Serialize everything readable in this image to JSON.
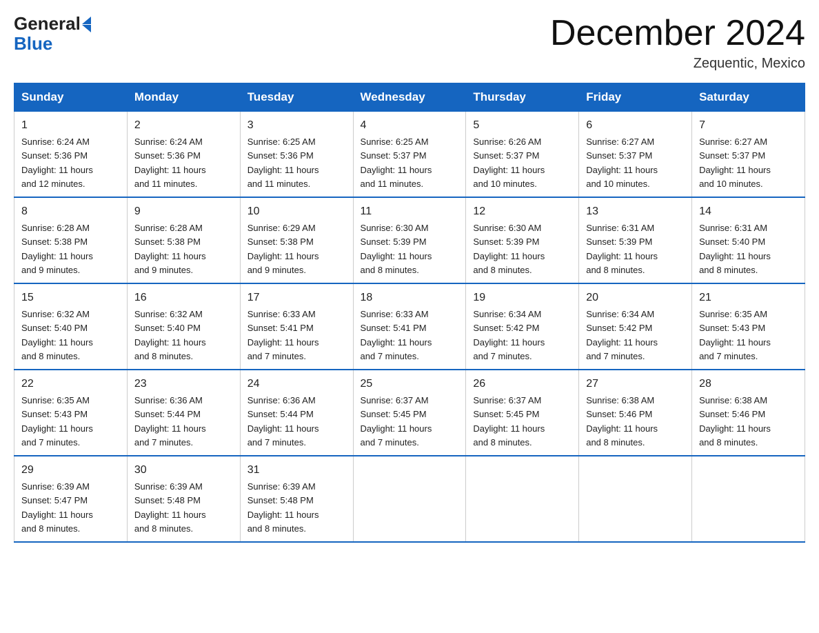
{
  "logo": {
    "general": "General",
    "blue": "Blue"
  },
  "title": "December 2024",
  "location": "Zequentic, Mexico",
  "days_of_week": [
    "Sunday",
    "Monday",
    "Tuesday",
    "Wednesday",
    "Thursday",
    "Friday",
    "Saturday"
  ],
  "weeks": [
    [
      {
        "day": "1",
        "sunrise": "6:24 AM",
        "sunset": "5:36 PM",
        "daylight": "11 hours and 12 minutes."
      },
      {
        "day": "2",
        "sunrise": "6:24 AM",
        "sunset": "5:36 PM",
        "daylight": "11 hours and 11 minutes."
      },
      {
        "day": "3",
        "sunrise": "6:25 AM",
        "sunset": "5:36 PM",
        "daylight": "11 hours and 11 minutes."
      },
      {
        "day": "4",
        "sunrise": "6:25 AM",
        "sunset": "5:37 PM",
        "daylight": "11 hours and 11 minutes."
      },
      {
        "day": "5",
        "sunrise": "6:26 AM",
        "sunset": "5:37 PM",
        "daylight": "11 hours and 10 minutes."
      },
      {
        "day": "6",
        "sunrise": "6:27 AM",
        "sunset": "5:37 PM",
        "daylight": "11 hours and 10 minutes."
      },
      {
        "day": "7",
        "sunrise": "6:27 AM",
        "sunset": "5:37 PM",
        "daylight": "11 hours and 10 minutes."
      }
    ],
    [
      {
        "day": "8",
        "sunrise": "6:28 AM",
        "sunset": "5:38 PM",
        "daylight": "11 hours and 9 minutes."
      },
      {
        "day": "9",
        "sunrise": "6:28 AM",
        "sunset": "5:38 PM",
        "daylight": "11 hours and 9 minutes."
      },
      {
        "day": "10",
        "sunrise": "6:29 AM",
        "sunset": "5:38 PM",
        "daylight": "11 hours and 9 minutes."
      },
      {
        "day": "11",
        "sunrise": "6:30 AM",
        "sunset": "5:39 PM",
        "daylight": "11 hours and 8 minutes."
      },
      {
        "day": "12",
        "sunrise": "6:30 AM",
        "sunset": "5:39 PM",
        "daylight": "11 hours and 8 minutes."
      },
      {
        "day": "13",
        "sunrise": "6:31 AM",
        "sunset": "5:39 PM",
        "daylight": "11 hours and 8 minutes."
      },
      {
        "day": "14",
        "sunrise": "6:31 AM",
        "sunset": "5:40 PM",
        "daylight": "11 hours and 8 minutes."
      }
    ],
    [
      {
        "day": "15",
        "sunrise": "6:32 AM",
        "sunset": "5:40 PM",
        "daylight": "11 hours and 8 minutes."
      },
      {
        "day": "16",
        "sunrise": "6:32 AM",
        "sunset": "5:40 PM",
        "daylight": "11 hours and 8 minutes."
      },
      {
        "day": "17",
        "sunrise": "6:33 AM",
        "sunset": "5:41 PM",
        "daylight": "11 hours and 7 minutes."
      },
      {
        "day": "18",
        "sunrise": "6:33 AM",
        "sunset": "5:41 PM",
        "daylight": "11 hours and 7 minutes."
      },
      {
        "day": "19",
        "sunrise": "6:34 AM",
        "sunset": "5:42 PM",
        "daylight": "11 hours and 7 minutes."
      },
      {
        "day": "20",
        "sunrise": "6:34 AM",
        "sunset": "5:42 PM",
        "daylight": "11 hours and 7 minutes."
      },
      {
        "day": "21",
        "sunrise": "6:35 AM",
        "sunset": "5:43 PM",
        "daylight": "11 hours and 7 minutes."
      }
    ],
    [
      {
        "day": "22",
        "sunrise": "6:35 AM",
        "sunset": "5:43 PM",
        "daylight": "11 hours and 7 minutes."
      },
      {
        "day": "23",
        "sunrise": "6:36 AM",
        "sunset": "5:44 PM",
        "daylight": "11 hours and 7 minutes."
      },
      {
        "day": "24",
        "sunrise": "6:36 AM",
        "sunset": "5:44 PM",
        "daylight": "11 hours and 7 minutes."
      },
      {
        "day": "25",
        "sunrise": "6:37 AM",
        "sunset": "5:45 PM",
        "daylight": "11 hours and 7 minutes."
      },
      {
        "day": "26",
        "sunrise": "6:37 AM",
        "sunset": "5:45 PM",
        "daylight": "11 hours and 8 minutes."
      },
      {
        "day": "27",
        "sunrise": "6:38 AM",
        "sunset": "5:46 PM",
        "daylight": "11 hours and 8 minutes."
      },
      {
        "day": "28",
        "sunrise": "6:38 AM",
        "sunset": "5:46 PM",
        "daylight": "11 hours and 8 minutes."
      }
    ],
    [
      {
        "day": "29",
        "sunrise": "6:39 AM",
        "sunset": "5:47 PM",
        "daylight": "11 hours and 8 minutes."
      },
      {
        "day": "30",
        "sunrise": "6:39 AM",
        "sunset": "5:48 PM",
        "daylight": "11 hours and 8 minutes."
      },
      {
        "day": "31",
        "sunrise": "6:39 AM",
        "sunset": "5:48 PM",
        "daylight": "11 hours and 8 minutes."
      },
      null,
      null,
      null,
      null
    ]
  ],
  "labels": {
    "sunrise": "Sunrise:",
    "sunset": "Sunset:",
    "daylight": "Daylight:"
  }
}
